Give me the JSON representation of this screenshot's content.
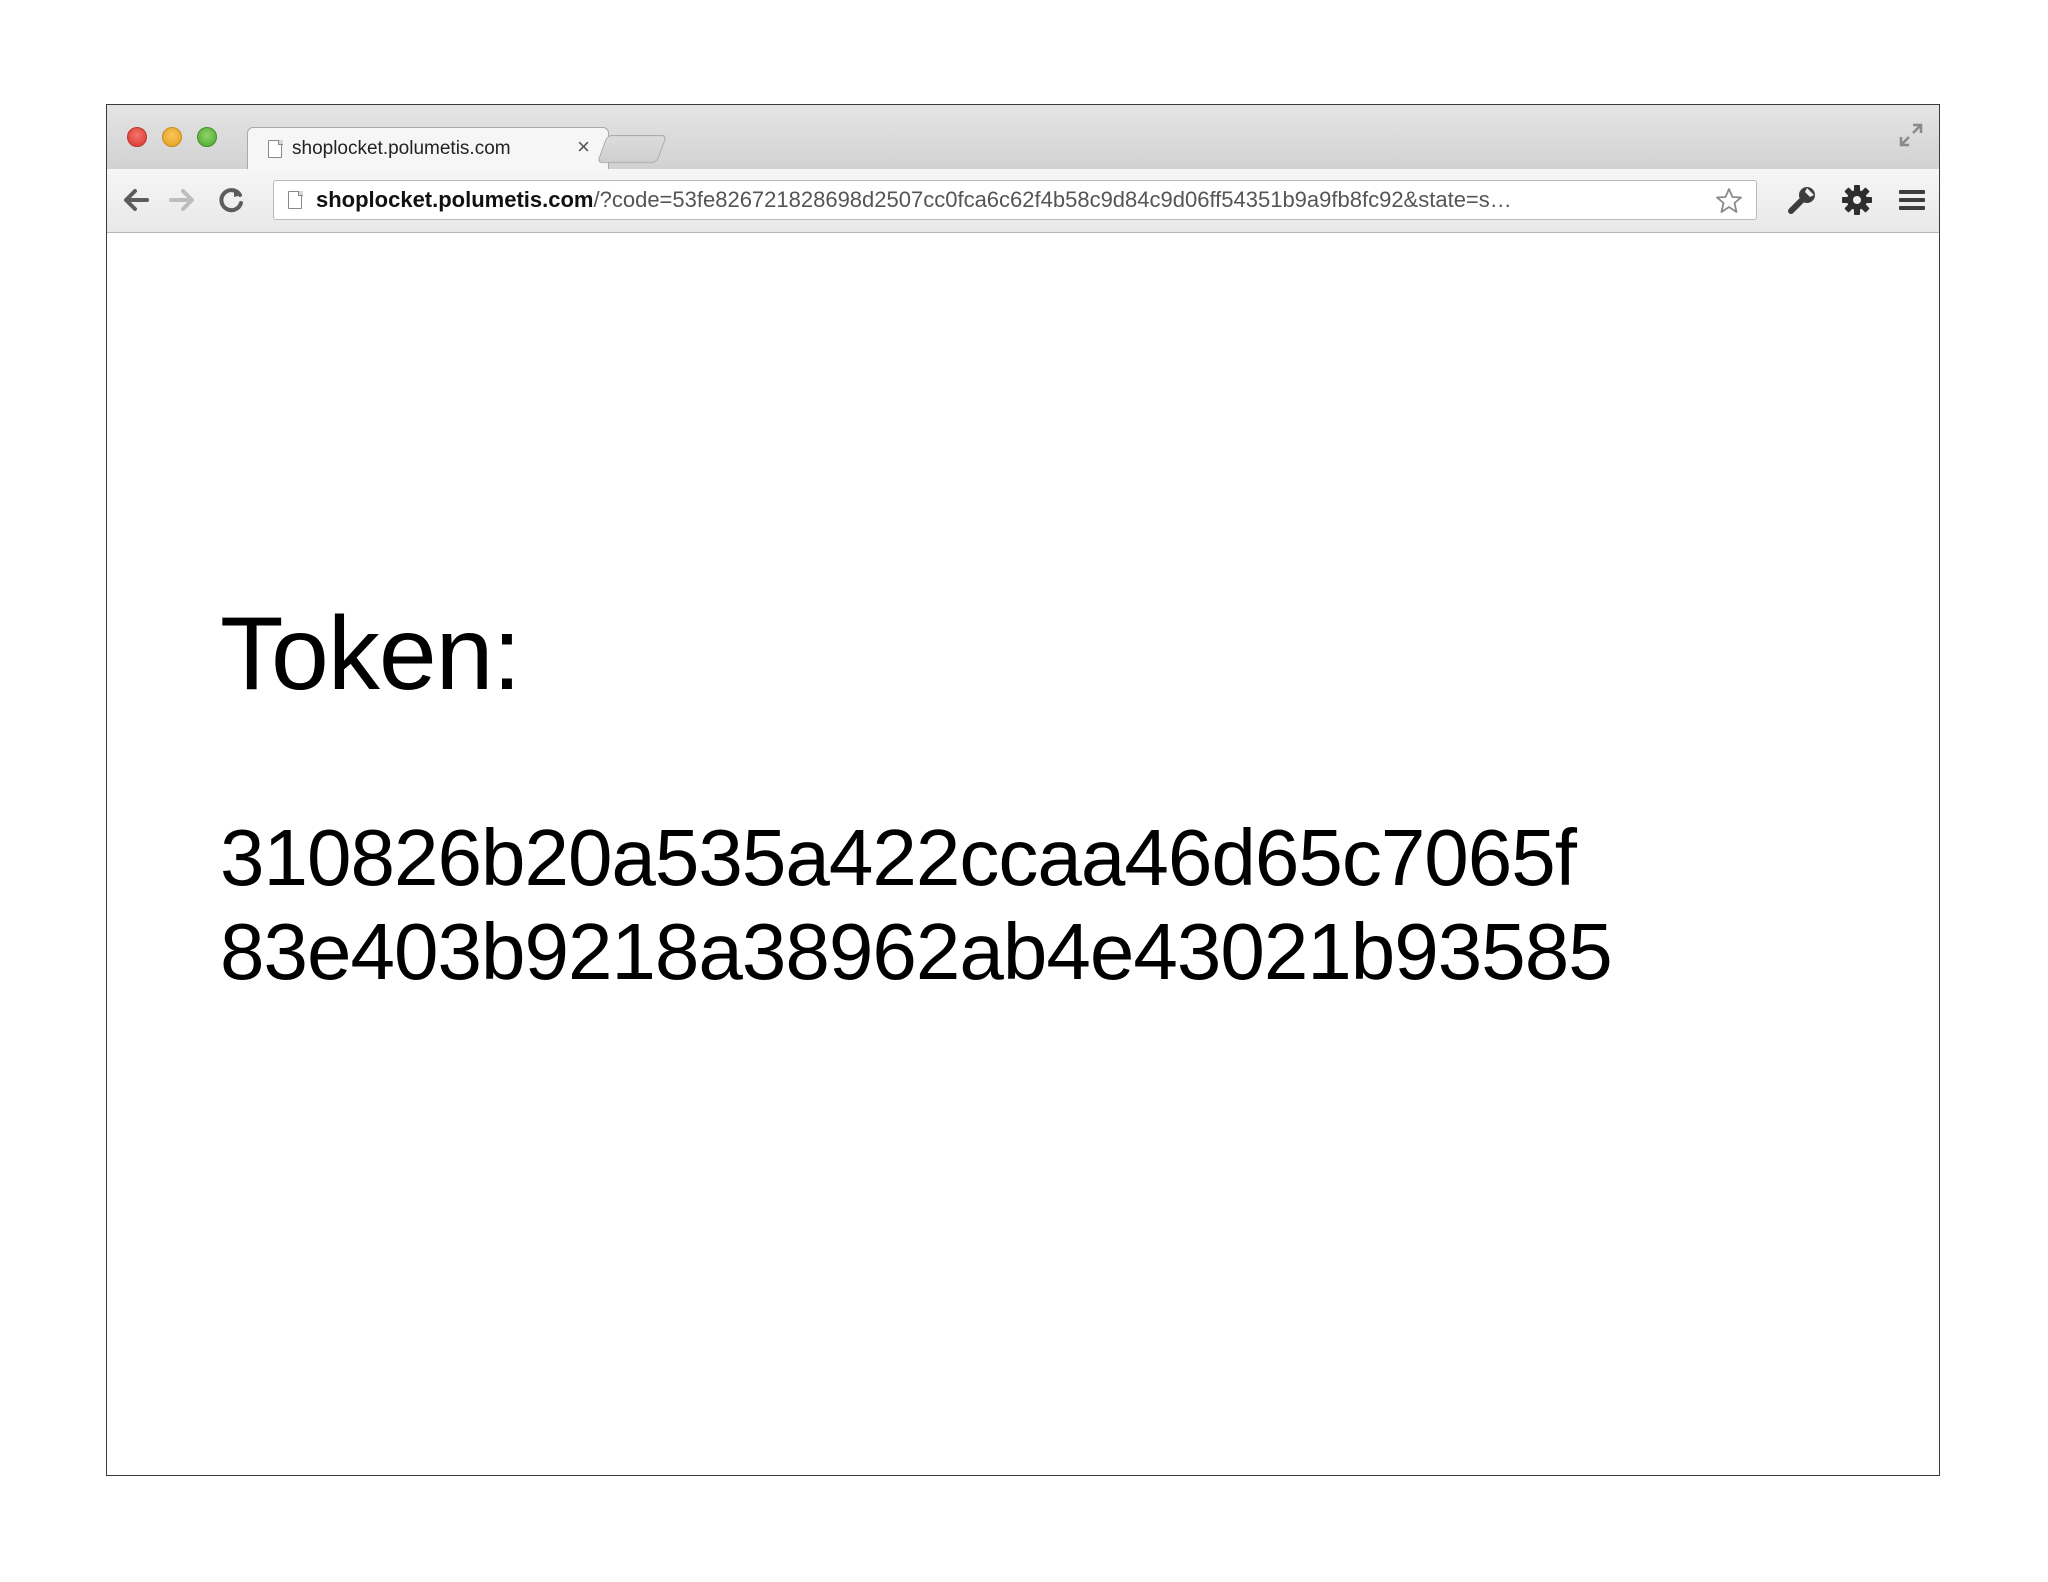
{
  "window": {
    "controls": [
      "close",
      "minimize",
      "maximize"
    ]
  },
  "tab": {
    "title": "shoplocket.polumetis.com",
    "close_label": "×"
  },
  "address_bar": {
    "host": "shoplocket.polumetis.com",
    "path": "/?code=53fe826721828698d2507cc0fca6c62f4b58c9d84c9d06ff54351b9a9fb8fc92&state=s…"
  },
  "icons": {
    "back": "arrow-left-icon",
    "forward": "arrow-right-icon",
    "reload": "reload-icon",
    "bookmark": "star-icon",
    "wrench": "wrench-icon",
    "settings": "gear-icon",
    "menu": "menu-icon",
    "fullscreen": "fullscreen-icon"
  },
  "page": {
    "label": "Token:",
    "token_lines": [
      "310826b20a535a422ccaa46d65c7065f",
      "83e403b9218a38962ab4e43021b93585"
    ]
  }
}
